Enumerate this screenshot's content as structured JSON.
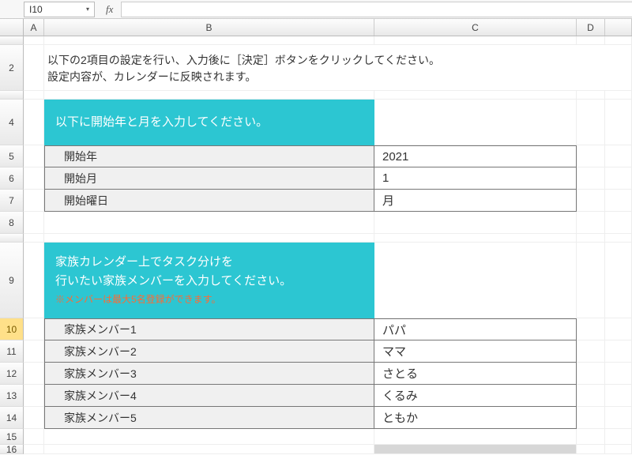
{
  "formula_bar": {
    "cell_ref": "I10",
    "fx": "fx",
    "formula": ""
  },
  "columns": [
    "A",
    "B",
    "C",
    "D",
    ""
  ],
  "row_numbers": [
    "",
    "2",
    "",
    "4",
    "5",
    "6",
    "7",
    "8",
    "",
    "9",
    "10",
    "11",
    "12",
    "13",
    "14",
    "15",
    "16"
  ],
  "selected_row": "10",
  "intro": {
    "line1": "以下の2項目の設定を行い、入力後に［決定］ボタンをクリックしてください。",
    "line2": "設定内容が、カレンダーに反映されます。"
  },
  "section1": {
    "banner": "以下に開始年と月を入力してください。",
    "rows": [
      {
        "label": "開始年",
        "value": "2021"
      },
      {
        "label": "開始月",
        "value": "1"
      },
      {
        "label": "開始曜日",
        "value": "月"
      }
    ]
  },
  "section2": {
    "banner_l1": "家族カレンダー上でタスク分けを",
    "banner_l2": "行いたい家族メンバーを入力してください。",
    "banner_note": "※メンバーは最大5名登録ができます。",
    "rows": [
      {
        "label": "家族メンバー1",
        "value": "パパ"
      },
      {
        "label": "家族メンバー2",
        "value": "ママ"
      },
      {
        "label": "家族メンバー3",
        "value": "さとる"
      },
      {
        "label": "家族メンバー4",
        "value": "くるみ"
      },
      {
        "label": "家族メンバー5",
        "value": "ともか"
      }
    ]
  }
}
